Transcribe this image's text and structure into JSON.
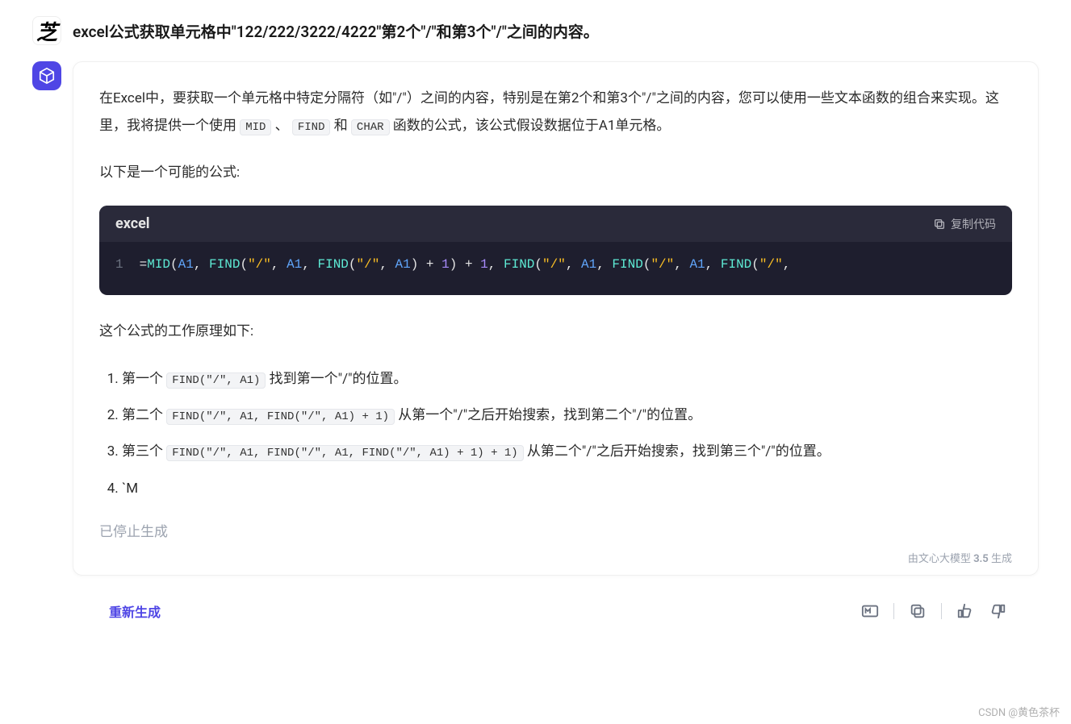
{
  "user_message": "excel公式获取单元格中\"122/222/3222/4222\"第2个\"/\"和第3个\"/\"之间的内容。",
  "response": {
    "intro_part1": "在Excel中，要获取一个单元格中特定分隔符（如\"/\"）之间的内容，特别是在第2个和第3个\"/\"之间的内容，您可以使用一些文本函数的组合来实现。这里，我将提供一个使用 ",
    "intro_code1": "MID",
    "intro_sep1": " 、 ",
    "intro_code2": "FIND",
    "intro_sep2": " 和 ",
    "intro_code3": "CHAR",
    "intro_part2": " 函数的公式，该公式假设数据位于A1单元格。",
    "para2": "以下是一个可能的公式:",
    "code": {
      "language": "excel",
      "copy_label": "复制代码",
      "line_number": "1",
      "tokens": {
        "eq": "=",
        "mid": "MID",
        "lp": "(",
        "a1": "A1",
        "comma": ", ",
        "find": "FIND",
        "slash": "\"/\"",
        "rp": ")",
        "plus": " + ",
        "one": "1"
      }
    },
    "explain_title": "这个公式的工作原理如下:",
    "steps": [
      {
        "prefix": "第一个 ",
        "code": "FIND(\"/\", A1)",
        "suffix": " 找到第一个\"/\"的位置。"
      },
      {
        "prefix": "第二个 ",
        "code": "FIND(\"/\", A1, FIND(\"/\", A1) + 1)",
        "suffix": " 从第一个\"/\"之后开始搜索，找到第二个\"/\"的位置。"
      },
      {
        "prefix": "第三个 ",
        "code": "FIND(\"/\", A1, FIND(\"/\", A1, FIND(\"/\", A1) + 1) + 1)",
        "suffix": " 从第二个\"/\"之后开始搜索，找到第三个\"/\"的位置。"
      },
      {
        "prefix": "`M",
        "code": "",
        "suffix": ""
      }
    ],
    "stopped_text": "已停止生成",
    "generated_by_prefix": "由文心大模型 ",
    "generated_by_version": "3.5",
    "generated_by_suffix": " 生成"
  },
  "actions": {
    "regenerate": "重新生成"
  },
  "watermark": "CSDN @黄色茶杯"
}
